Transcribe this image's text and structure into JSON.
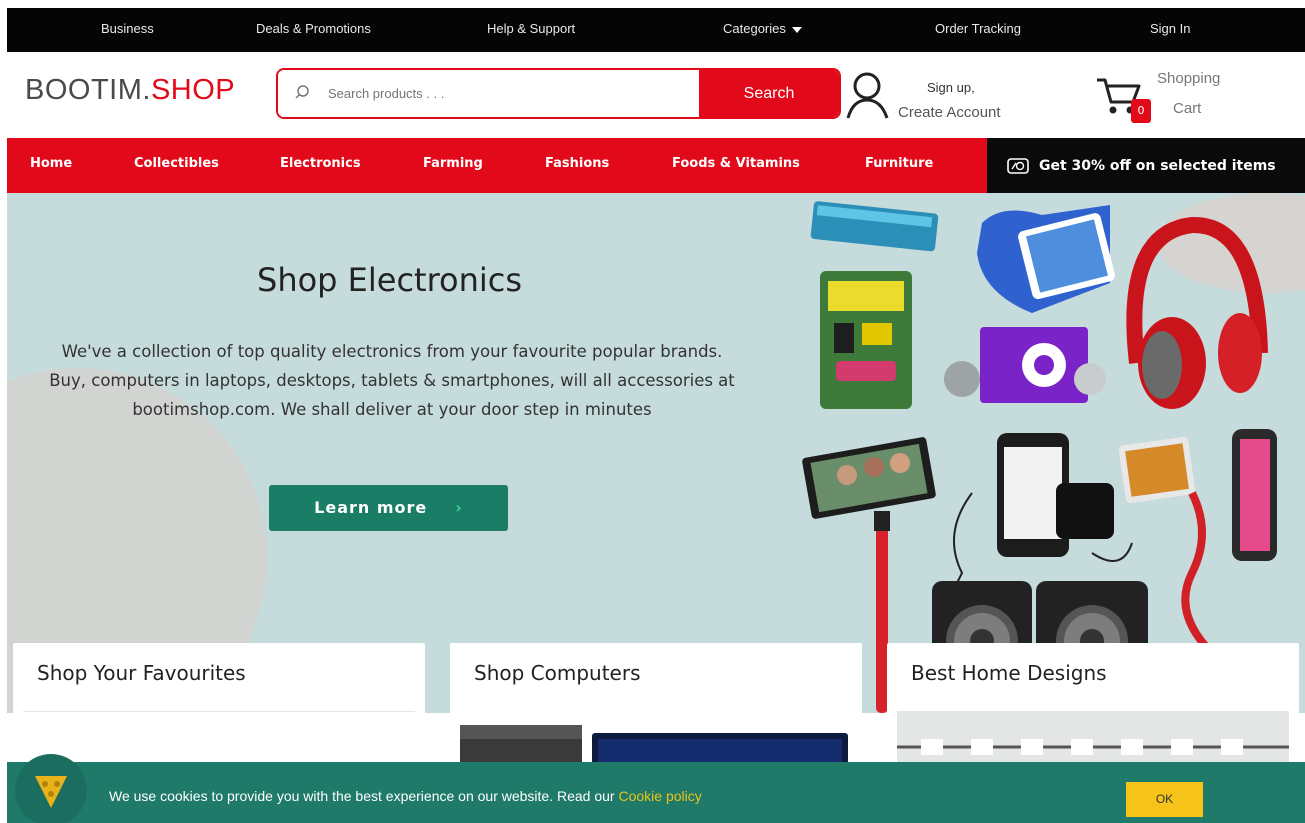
{
  "topbar": {
    "items": [
      "Business",
      "Deals & Promotions",
      "Help & Support",
      "Categories",
      "Order Tracking",
      "Sign In"
    ]
  },
  "header": {
    "logo_part1": "BOOTIM.",
    "logo_part2": "SHOP",
    "search_placeholder": "Search products . . .",
    "search_button": "Search",
    "signup_line1": "Sign up,",
    "signup_line2": "Create Account",
    "cart_count": "0",
    "cart_line1": "Shopping",
    "cart_line2": "Cart"
  },
  "nav": {
    "items": [
      "Home",
      "Collectibles",
      "Electronics",
      "Farming",
      "Fashions",
      "Foods & Vitamins",
      "Furniture"
    ],
    "promo": "Get 30% off on selected items"
  },
  "hero": {
    "title": "Shop Electronics",
    "text": "We've a collection of top quality electronics from your favourite popular brands. Buy, computers in laptops, desktops, tablets & smartphones, will all accessories at bootimshop.com. We shall deliver at your door step in minutes",
    "button": "Learn more",
    "button_chevron": "›"
  },
  "cards": [
    {
      "title": "Shop Your Favourites"
    },
    {
      "title": "Shop Computers"
    },
    {
      "title": "Best Home Designs"
    }
  ],
  "cookie": {
    "text": "We use cookies to provide you with the best experience on our website. Read our ",
    "link": "Cookie policy",
    "ok": "OK"
  },
  "colors": {
    "brand_red": "#e20a1a",
    "topbar_bg": "#050505",
    "hero_bg": "#c6dbdc",
    "button_green": "#1a7d66",
    "cookie_bg": "#1f7a6a",
    "ok_yellow": "#f5c319"
  }
}
